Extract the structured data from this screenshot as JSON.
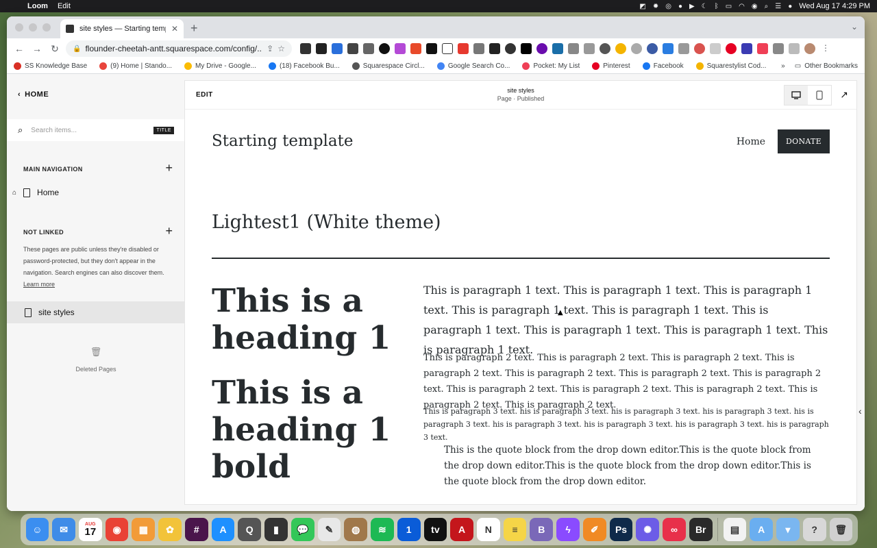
{
  "menubar": {
    "app_name": "Loom",
    "menu_edit": "Edit",
    "datetime": "Wed Aug 17  4:29 PM"
  },
  "browser": {
    "tab_title": "site styles — Starting template",
    "url": "flounder-cheetah-antt.squarespace.com/config/...",
    "bookmarks": [
      {
        "label": "SS Knowledge Base",
        "color": "#d93025"
      },
      {
        "label": "(9) Home | Stando...",
        "color": "#e8453c"
      },
      {
        "label": "My Drive - Google...",
        "color": "#fbbc04"
      },
      {
        "label": "(18) Facebook Bu...",
        "color": "#1877f2"
      },
      {
        "label": "Squarespace Circl...",
        "color": "#555555"
      },
      {
        "label": "Google Search Co...",
        "color": "#4285f4"
      },
      {
        "label": "Pocket: My List",
        "color": "#ef3f56"
      },
      {
        "label": "Pinterest",
        "color": "#e60023"
      },
      {
        "label": "Facebook",
        "color": "#1877f2"
      },
      {
        "label": "Squarestylist Cod...",
        "color": "#f4b400"
      }
    ],
    "more_label": "»",
    "other_bookmarks": "Other Bookmarks"
  },
  "sidebar": {
    "back_label": "HOME",
    "search_placeholder": "Search items...",
    "search_pill": "TITLE",
    "main_nav_header": "MAIN NAVIGATION",
    "main_nav_items": [
      {
        "label": "Home"
      }
    ],
    "not_linked_header": "NOT LINKED",
    "not_linked_desc": "These pages are public unless they're disabled or password-protected, but they don't appear in the navigation. Search engines can also discover them.",
    "learn_more": "Learn more",
    "not_linked_items": [
      {
        "label": "site styles"
      }
    ],
    "deleted_pages": "Deleted Pages"
  },
  "preview": {
    "edit_label": "EDIT",
    "page_title": "site styles",
    "page_status": "Page · Published"
  },
  "site": {
    "logo": "Starting template",
    "nav_home": "Home",
    "donate": "DONATE",
    "theme_heading": "Lightest1 (White theme)",
    "heading1": "This is a heading 1",
    "heading1_bold": "This is a heading 1 bold",
    "paragraph1": "This is paragraph 1 text. This is paragraph 1 text. This is paragraph 1 text. This is paragraph 1 text. This is paragraph 1 text. This is paragraph 1 text. This is paragraph 1 text. This is paragraph 1 text. This is paragraph 1 text.",
    "paragraph2": "This is paragraph 2 text. This is paragraph 2 text. This is paragraph 2 text. This is paragraph 2 text. This is paragraph 2 text. This is paragraph 2 text. This is paragraph 2 text. This is paragraph 2 text. This is paragraph 2 text. This is paragraph 2 text. This is paragraph 2 text. This is paragraph 2 text.",
    "paragraph3": "This is paragraph 3 text. his is paragraph 3 text. his is paragraph 3 text. his is paragraph 3 text. his is paragraph 3 text. his is paragraph 3 text. his is paragraph 3 text. his is paragraph 3 text. his is paragraph 3 text.",
    "quote": "This is the quote block from the drop down editor.This is the quote block from the drop down editor.This is the quote block from the drop down editor.This is the quote block from the drop down editor."
  },
  "dock": {
    "calendar_month": "AUG",
    "calendar_day": "17",
    "icons": [
      {
        "name": "finder-icon",
        "color": "#3b8ef0",
        "glyph": "☺"
      },
      {
        "name": "mail-icon",
        "color": "#3f8ce8",
        "glyph": "✉"
      },
      {
        "name": "calendar-icon",
        "color": "#ffffff",
        "glyph": ""
      },
      {
        "name": "chrome-icon",
        "color": "#e94235",
        "glyph": "◉"
      },
      {
        "name": "launchpad-icon",
        "color": "#f29b38",
        "glyph": "▦"
      },
      {
        "name": "photos-icon",
        "color": "#f2c33a",
        "glyph": "✿"
      },
      {
        "name": "slack-icon",
        "color": "#4a154b",
        "glyph": "#"
      },
      {
        "name": "app-store-icon",
        "color": "#1e90ff",
        "glyph": "A"
      },
      {
        "name": "quicktime-icon",
        "color": "#555555",
        "glyph": "Q"
      },
      {
        "name": "screen-record-icon",
        "color": "#333333",
        "glyph": "▮"
      },
      {
        "name": "messages-icon",
        "color": "#34c759",
        "glyph": "💬"
      },
      {
        "name": "textedit-icon",
        "color": "#e8e8e8",
        "glyph": "✎"
      },
      {
        "name": "keka-icon",
        "color": "#a0784a",
        "glyph": "◍"
      },
      {
        "name": "spotify-icon",
        "color": "#1db954",
        "glyph": "≋"
      },
      {
        "name": "1password-icon",
        "color": "#0a5cd8",
        "glyph": "1"
      },
      {
        "name": "appletv-icon",
        "color": "#111111",
        "glyph": "tv"
      },
      {
        "name": "acrobat-icon",
        "color": "#c4161c",
        "glyph": "A"
      },
      {
        "name": "notion-icon",
        "color": "#ffffff",
        "glyph": "N"
      },
      {
        "name": "notes-icon",
        "color": "#f5d547",
        "glyph": "≡"
      },
      {
        "name": "bbedit-icon",
        "color": "#7a68b8",
        "glyph": "B"
      },
      {
        "name": "messenger-icon",
        "color": "#8a4bff",
        "glyph": "ϟ"
      },
      {
        "name": "pages-icon",
        "color": "#f08a24",
        "glyph": "✐"
      },
      {
        "name": "photoshop-icon",
        "color": "#0f2a4a",
        "glyph": "Ps"
      },
      {
        "name": "settings-icon",
        "color": "#6c5ce7",
        "glyph": "✺"
      },
      {
        "name": "creative-cloud-icon",
        "color": "#e8304a",
        "glyph": "∞"
      },
      {
        "name": "bridge-icon",
        "color": "#2a2a2a",
        "glyph": "Br"
      },
      {
        "name": "document-icon",
        "color": "#f2f2f2",
        "glyph": "▤"
      },
      {
        "name": "applications-folder-icon",
        "color": "#6aaef0",
        "glyph": "A"
      },
      {
        "name": "downloads-folder-icon",
        "color": "#7ab6f0",
        "glyph": "▾"
      },
      {
        "name": "help-icon",
        "color": "#d8d8d8",
        "glyph": "?"
      },
      {
        "name": "trash-icon",
        "color": "#d0d0d0",
        "glyph": "🗑"
      }
    ]
  }
}
